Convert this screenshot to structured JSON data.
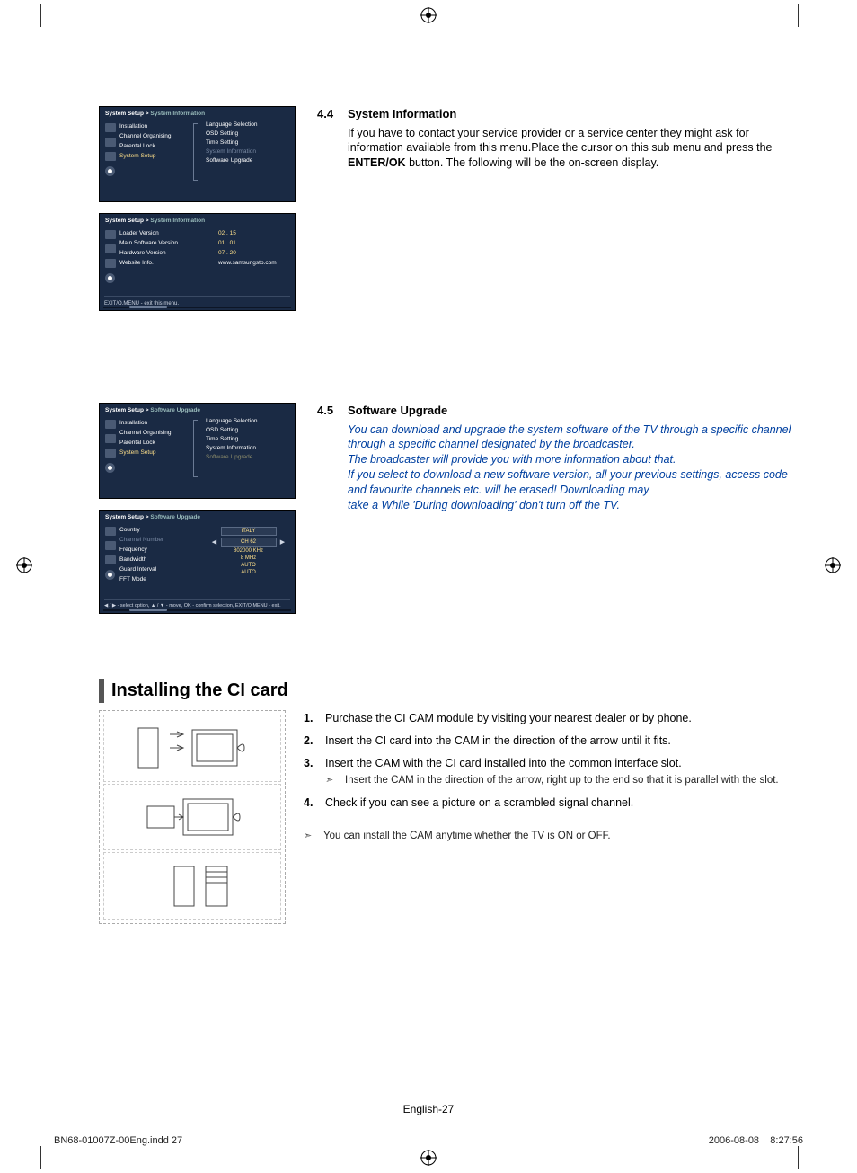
{
  "panel1": {
    "breadcrumb_a": "System Setup >",
    "breadcrumb_b": "System Information",
    "left": [
      "Installation",
      "Channel Organising",
      "Parental Lock"
    ],
    "left_sel": "System Setup",
    "right": [
      "Language Selection",
      "OSD Setting",
      "Time Setting"
    ],
    "right_dim": "System Information",
    "right_last": "Software Upgrade"
  },
  "panel2": {
    "breadcrumb_a": "System Setup >",
    "breadcrumb_b": "System Information",
    "labels": [
      "Loader Version",
      "Main Software Version",
      "Hardware Version",
      "Website Info."
    ],
    "values": [
      "02 . 15",
      "01 . 01",
      "07 . 20",
      "www.samsungstb.com"
    ],
    "help": "EXIT/O.MENU - exit this menu."
  },
  "sec44": {
    "num": "4.4",
    "title": "System Information",
    "p1a": "If you have to contact your service provider or a service center they might ask for information available from this menu.Place the cursor on this sub menu and press the ",
    "p1b": "ENTER/OK",
    "p1c": " button. The following will be the on-screen display."
  },
  "panel3": {
    "breadcrumb_a": "System Setup >",
    "breadcrumb_b": "Software Upgrade",
    "left": [
      "Installation",
      "Channel Organising",
      "Parental Lock"
    ],
    "left_sel": "System Setup",
    "right": [
      "Language Selection",
      "OSD Setting",
      "Time Setting",
      "System Information"
    ],
    "right_dim": "Software Upgrade"
  },
  "panel4": {
    "breadcrumb_a": "System Setup >",
    "breadcrumb_b": "Software Upgrade",
    "rows": [
      {
        "label": "Country",
        "val": "ITALY",
        "pill": true,
        "arrows": false
      },
      {
        "label": "Channel Number",
        "val": "CH   62",
        "pill": true,
        "arrows": true,
        "dim": true
      },
      {
        "label": "Frequency",
        "val": "802000 KHz"
      },
      {
        "label": "Bandwidth",
        "val": "8 MHz"
      },
      {
        "label": "Guard Interval",
        "val": "AUTO"
      },
      {
        "label": "FFT Mode",
        "val": "AUTO"
      }
    ],
    "help": "◀ / ▶ - select option, ▲ / ▼ - move, OK - confirm selection, EXIT/O.MENU - exit."
  },
  "sec45": {
    "num": "4.5",
    "title": "Software Upgrade",
    "lines": [
      "You can download and upgrade the system software of the TV through a specific channel through a specific channel designated by the broadcaster.",
      "The broadcaster will provide you with more information about that.",
      "If you select to download a new software version, all your previous settings, access code and favourite channels etc. will be erased! Downloading may",
      "take a While 'During downloading' don't turn off the TV."
    ]
  },
  "installing": {
    "title": "Installing the CI card",
    "steps": [
      "Purchase the CI CAM module by visiting your nearest dealer or by phone.",
      "Insert the CI card into the CAM in the direction of the arrow until it fits.",
      "Insert the CAM with the CI card installed into the common interface slot.",
      "Check if you can see a picture on a scrambled signal channel."
    ],
    "step3_note": "Insert the CAM in the direction of the arrow, right up to the end so that it is parallel with the slot.",
    "bottom_note": "You can install the CAM anytime whether the TV is ON or OFF."
  },
  "footer": {
    "page": "English-27",
    "left": "BN68-01007Z-00Eng.indd   27",
    "date": "2006-08-08",
    "time": "8:27:56"
  }
}
